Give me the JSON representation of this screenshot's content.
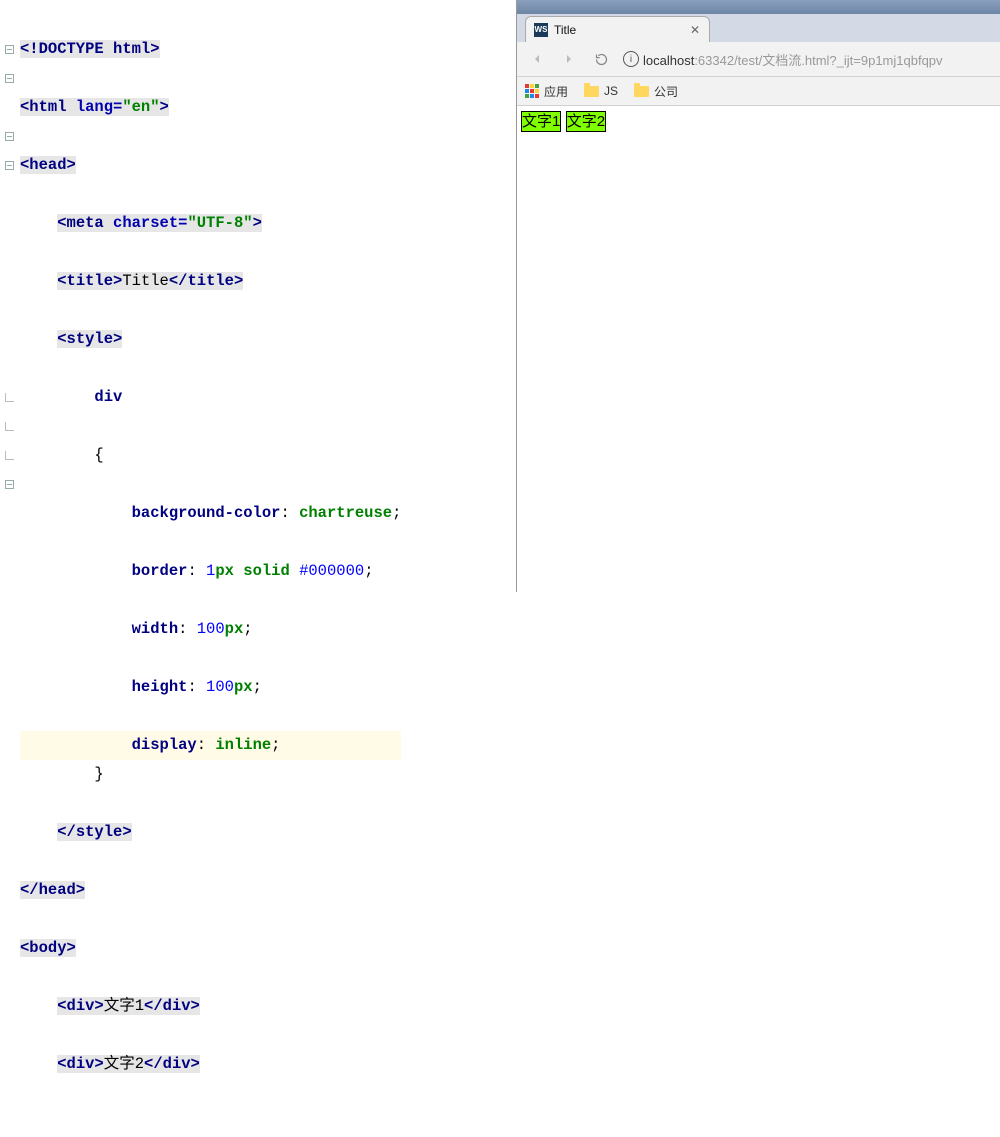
{
  "editor": {
    "lines": {
      "l1": {
        "doctype": "<!DOCTYPE html>"
      },
      "l2": {
        "open": "<html ",
        "attr": "lang=",
        "val": "\"en\"",
        "close": ">"
      },
      "l3": {
        "open": "<head>",
        "close": ""
      },
      "l4": {
        "indent": "    ",
        "open": "<meta ",
        "attr": "charset=",
        "val": "\"UTF-8\"",
        "close": ">"
      },
      "l5": {
        "indent": "    ",
        "open": "<title>",
        "text": "Title",
        "close": "</title>"
      },
      "l6": {
        "indent": "    ",
        "open": "<style>"
      },
      "l7": {
        "indent": "        ",
        "sel": "div"
      },
      "l8": {
        "indent": "        ",
        "brace": "{"
      },
      "l9": {
        "indent": "            ",
        "prop": "background-color",
        "colon": ": ",
        "val": "chartreuse",
        "semi": ";"
      },
      "l10": {
        "indent": "            ",
        "prop": "border",
        "colon": ": ",
        "num": "1",
        "unit": "px ",
        "kw": "solid ",
        "hex": "#000000",
        "semi": ";"
      },
      "l11": {
        "indent": "            ",
        "prop": "width",
        "colon": ": ",
        "num": "100",
        "unit": "px",
        "semi": ";"
      },
      "l12": {
        "indent": "            ",
        "prop": "height",
        "colon": ": ",
        "num": "100",
        "unit": "px",
        "semi": ";"
      },
      "l13": {
        "indent": "            ",
        "prop": "display",
        "colon": ": ",
        "val": "inline",
        "semi": ";"
      },
      "l14": {
        "indent": "        ",
        "brace": "}"
      },
      "l15": {
        "indent": "    ",
        "close": "</style>"
      },
      "l16": {
        "close": "</head>"
      },
      "l17": {
        "open": "<body>"
      },
      "l18": {
        "indent": "    ",
        "open": "<div>",
        "text": "文字1",
        "close": "</div>"
      },
      "l19": {
        "indent": "    ",
        "open": "<div>",
        "text": "文字2",
        "close": "</div>"
      }
    }
  },
  "browser": {
    "tab_title": "Title",
    "tab_icon_label": "WS",
    "url_host": "localhost",
    "url_port_path": ":63342/test/文档流.html?_ijt=9p1mj1qbfqpv",
    "bookmarks": {
      "apps": "应用",
      "js": "JS",
      "company": "公司"
    },
    "page": {
      "div1": "文字1",
      "div2": "文字2"
    }
  }
}
